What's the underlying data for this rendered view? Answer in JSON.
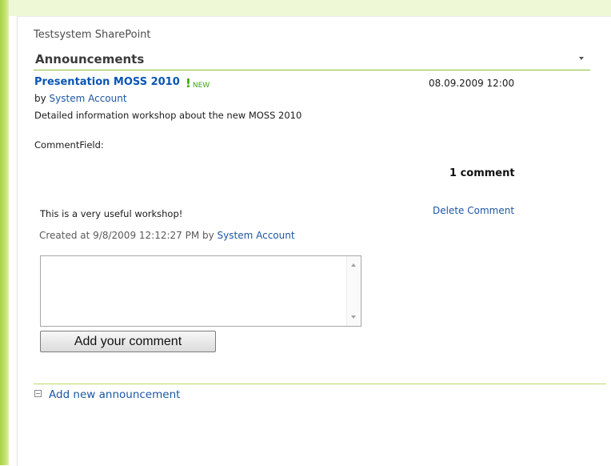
{
  "site": {
    "title": "Testsystem SharePoint"
  },
  "webpart": {
    "title": "Announcements"
  },
  "announcement": {
    "title": "Presentation MOSS 2010",
    "new_badge": "NEW",
    "date": "08.09.2009 12:00",
    "by_prefix": "by",
    "author": "System Account",
    "description": "Detailed information workshop about the new MOSS 2010",
    "comment_field_label": "CommentField:"
  },
  "comments": {
    "count_label": "1 comment",
    "items": [
      {
        "text": "This is a very useful workshop!",
        "delete_label": "Delete Comment",
        "created_prefix": "Created at 9/8/2009 12:12:27 PM by",
        "author": "System Account"
      }
    ],
    "input_value": "",
    "add_button_label": "Add your comment"
  },
  "footer": {
    "add_new_label": "Add new announcement"
  },
  "colors": {
    "accent_green": "#8fbc35",
    "link_blue": "#1d56a3",
    "title_blue": "#0b55b1",
    "new_green": "#39a614"
  },
  "icons": [
    "dropdown-arrow-icon",
    "new-exclamation-icon",
    "scroll-up-icon",
    "scroll-down-icon",
    "add-square-icon"
  ]
}
